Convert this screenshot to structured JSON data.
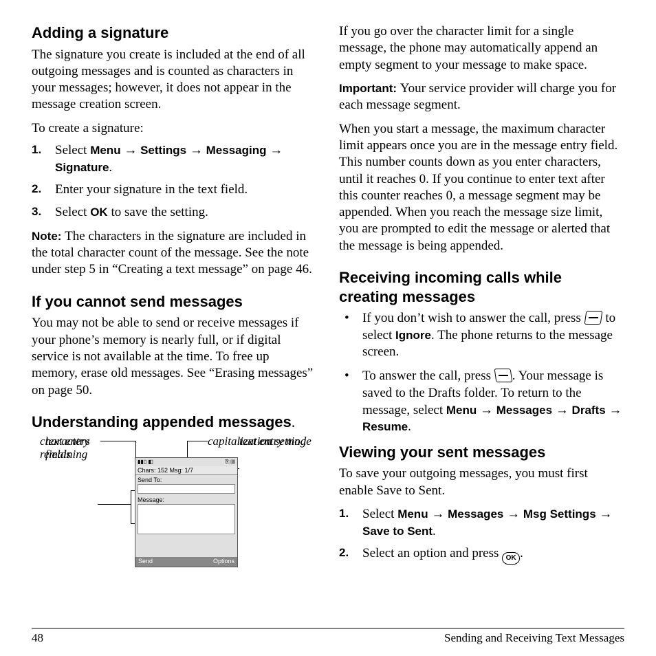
{
  "left": {
    "h_signature": "Adding a signature",
    "p_signature": "The signature you create is included at the end of all outgoing messages and is counted as characters in your messages; however, it does not appear in the message creation screen.",
    "p_create": "To create a signature:",
    "step1_prefix": "Select ",
    "menu": "Menu",
    "settings": "Settings",
    "messaging": "Messaging",
    "signature": "Signature",
    "step2": "Enter your signature in the text field.",
    "step3_prefix": "Select ",
    "ok": "OK",
    "step3_suffix": " to save the setting.",
    "note_label": "Note:  ",
    "note_body": "The characters in the signature are included in the total character count of the message. See the note under step 5 in “Creating a text message” on page 46.",
    "h_cannot": "If you cannot send messages",
    "p_cannot": "You may not be able to send or receive messages if your phone’s memory is nearly full, or if digital service is not available at the time. To free up memory, erase old messages. See “Erasing messages” on page 50.",
    "h_append": "Understanding appended messages",
    "diagram": {
      "chars_remaining": "characters remaining",
      "cap_setting": "capitalization setting",
      "text_entry_mode": "text entry mode",
      "text_entry_fields": "text entry fields",
      "screen_chars": "Chars: 152  Msg: 1/7",
      "screen_sendto": "Send To:",
      "screen_message": "Message:",
      "softkey_left": "Send",
      "softkey_right": "Options"
    }
  },
  "right": {
    "p_over": "If you go over the character limit for a single message, the phone may automatically append an empty segment to your message to make space.",
    "important_label": "Important:  ",
    "important_body": "Your service provider will charge you for each message segment.",
    "p_start": "When you start a message, the maximum character limit appears once you are in the message entry field. This number counts down as you enter characters, until it reaches 0. If you continue to enter text after this counter reaches 0, a message segment may be appended. When you reach the message size limit, you are prompted to edit the message or alerted that the message is being appended.",
    "h_receiving": "Receiving incoming calls while creating messages",
    "bullet1_a": "If you don’t wish to answer the call, press ",
    "bullet1_b": " to select ",
    "ignore": "Ignore",
    "bullet1_c": ". The phone returns to the message screen.",
    "bullet2_a": "To answer the call, press ",
    "bullet2_b": ". Your message is saved to the Drafts folder. To return to the message, select ",
    "menu": "Menu",
    "messages": "Messages",
    "drafts": "Drafts",
    "resume": "Resume",
    "h_viewing": "Viewing your sent messages",
    "p_viewing": "To save your outgoing messages, you must first enable Save to Sent.",
    "step1_prefix": "Select ",
    "msg_settings": "Msg Settings",
    "save_to_sent": "Save to Sent",
    "step2_a": "Select an option and press ",
    "ok": "OK",
    "step2_b": "."
  },
  "footer": {
    "page": "48",
    "title": "Sending and Receiving Text Messages"
  },
  "arrow": " → "
}
